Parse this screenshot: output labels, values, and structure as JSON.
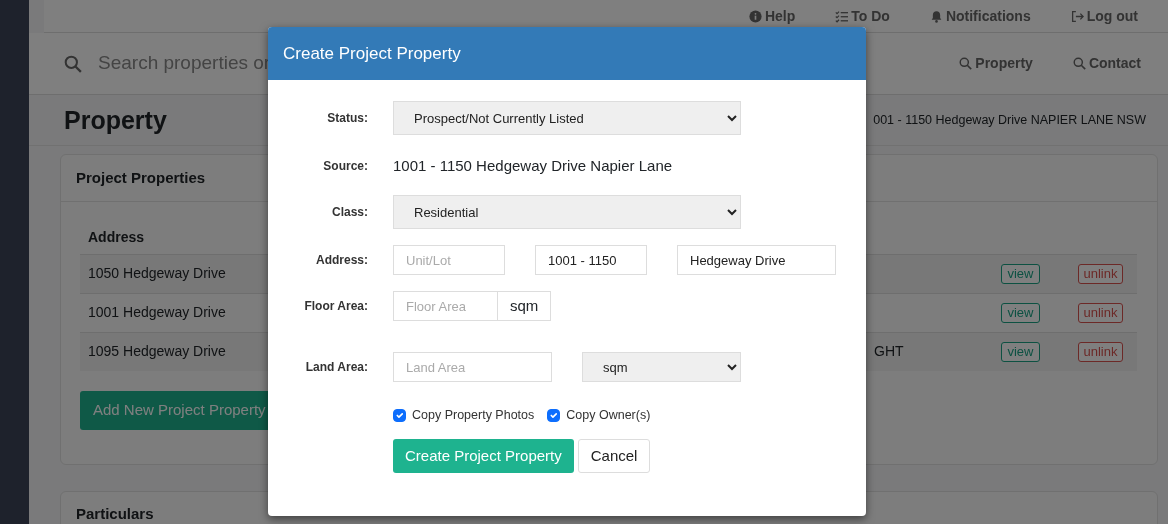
{
  "top_links": [
    {
      "label": "Help"
    },
    {
      "label": "To Do"
    },
    {
      "label": "Notifications"
    },
    {
      "label": "Log out"
    }
  ],
  "search": {
    "placeholder": "Search properties or",
    "scopes": [
      {
        "label": "Property"
      },
      {
        "label": "Contact"
      }
    ]
  },
  "page": {
    "title": "Property",
    "address": "001 - 1150 Hedgeway Drive NAPIER LANE NSW"
  },
  "project_properties": {
    "title": "Project Properties",
    "columns": [
      "Address"
    ],
    "rows": [
      {
        "address": "1050 Hedgeway Drive",
        "view": "view",
        "unlink": "unlink"
      },
      {
        "address": "1001 Hedgeway Drive",
        "view": "view",
        "unlink": "unlink"
      },
      {
        "address": "1095 Hedgeway Drive",
        "column_2": "GHT",
        "view": "view",
        "unlink": "unlink"
      }
    ],
    "add_button": "Add New Project Property"
  },
  "particulars": {
    "title": "Particulars"
  },
  "modal": {
    "title": "Create Project Property",
    "status": {
      "label": "Status:",
      "value": "Prospect/Not Currently Listed"
    },
    "source": {
      "label": "Source:",
      "value": "1001 - 1150 Hedgeway Drive Napier Lane"
    },
    "class": {
      "label": "Class:",
      "value": "Residential"
    },
    "address": {
      "label": "Address:",
      "unit": {
        "placeholder": "Unit/Lot"
      },
      "number": {
        "value": "1001 - 1150"
      },
      "street": {
        "value": "Hedgeway Drive"
      }
    },
    "floor_area": {
      "label": "Floor Area:",
      "placeholder": "Floor Area",
      "unit": "sqm"
    },
    "land_area": {
      "label": "Land Area:",
      "placeholder": "Land Area",
      "unit": "sqm"
    },
    "options": [
      {
        "label": "Copy Property Photos",
        "checked": true
      },
      {
        "label": "Copy Owner(s)",
        "checked": true
      }
    ],
    "buttons": [
      {
        "label": "Create Project Property",
        "kind": "primary"
      },
      {
        "label": "Cancel",
        "kind": "secondary"
      }
    ]
  }
}
